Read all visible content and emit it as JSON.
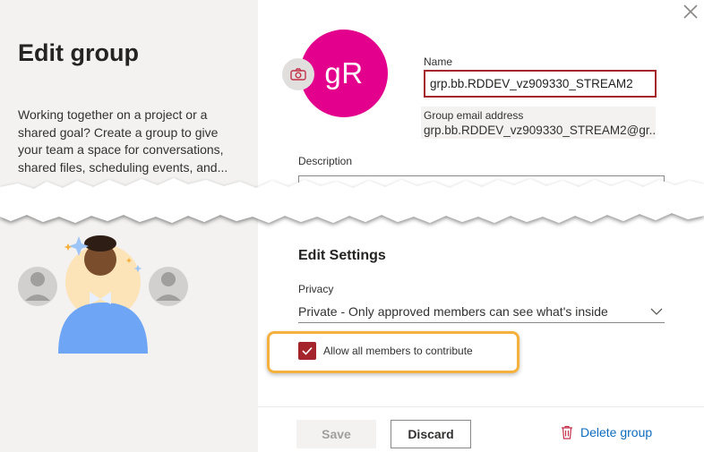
{
  "dialog": {
    "title": "Edit group",
    "intro": "Working together on a project or a shared goal? Create a group to give your team a space for conversations, shared files, scheduling events, and..."
  },
  "group": {
    "avatar_initials": "gR",
    "avatar_color": "#e3008c",
    "name_label": "Name",
    "name_value": "grp.bb.RDDEV_vz909330_STREAM2",
    "email_label": "Group email address",
    "email_value": "grp.bb.RDDEV_vz909330_STREAM2@gr...",
    "description_label": "Description"
  },
  "settings": {
    "title": "Edit Settings",
    "privacy_label": "Privacy",
    "privacy_value": "Private - Only approved members can see what's inside",
    "contribute_label": "Allow all members to contribute",
    "contribute_checked": true
  },
  "footer": {
    "save_label": "Save",
    "discard_label": "Discard",
    "delete_label": "Delete group"
  },
  "colors": {
    "accent": "#a4262c",
    "highlight": "#f4b13e",
    "link": "#0f6cbd"
  }
}
